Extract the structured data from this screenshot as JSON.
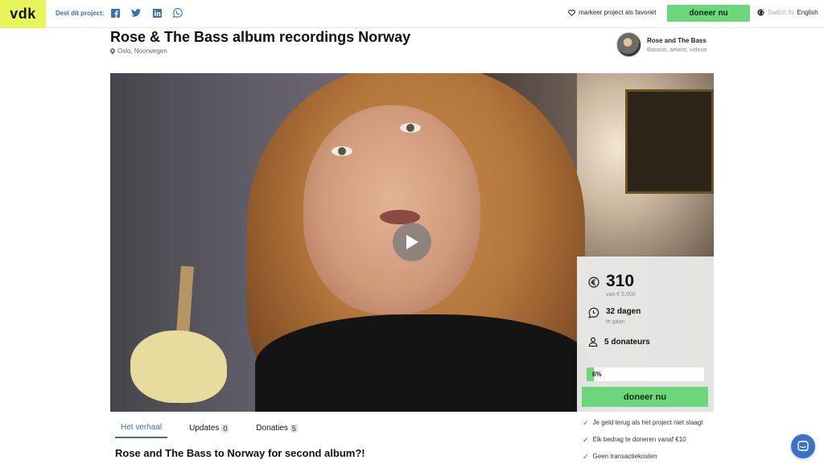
{
  "topbar": {
    "logo": "vdk",
    "share_label": "Deel dit project:",
    "share_icons": [
      "facebook-icon",
      "twitter-icon",
      "linkedin-icon",
      "whatsapp-icon"
    ],
    "favorite_label": "markeer project als favoriet",
    "donate_label": "doneer nu",
    "lang_prefix": "Switch to",
    "lang_target": "English"
  },
  "project": {
    "title": "Rose & The Bass album recordings Norway",
    "location": "Oslo, Noorwegen"
  },
  "creator": {
    "name": "Rose and The Bass",
    "subtitle": "Bassist, artiest, videos"
  },
  "stats": {
    "amount": "310",
    "goal": "van € 5.000",
    "days": "32 dagen",
    "days_sub": "te gaan",
    "donors": "5 donateurs",
    "progress_label": "6%",
    "progress_fraction": 0.062,
    "donate_label": "doneer nu"
  },
  "checks": [
    "Je geld terug als het project niet slaagt",
    "Elk bedrag te doneren vanaf €10",
    "Geen transactiekosten"
  ],
  "tabs": [
    {
      "label": "Het verhaal",
      "count": ""
    },
    {
      "label": "Updates",
      "count": "0"
    },
    {
      "label": "Donaties",
      "count": "5"
    }
  ],
  "story": {
    "title": "Rose and The Bass to Norway for second album?!"
  },
  "colors": {
    "brand_yellow": "#e8f55a",
    "accent_green": "#6bd67a",
    "link_blue": "#3a6fb0"
  }
}
